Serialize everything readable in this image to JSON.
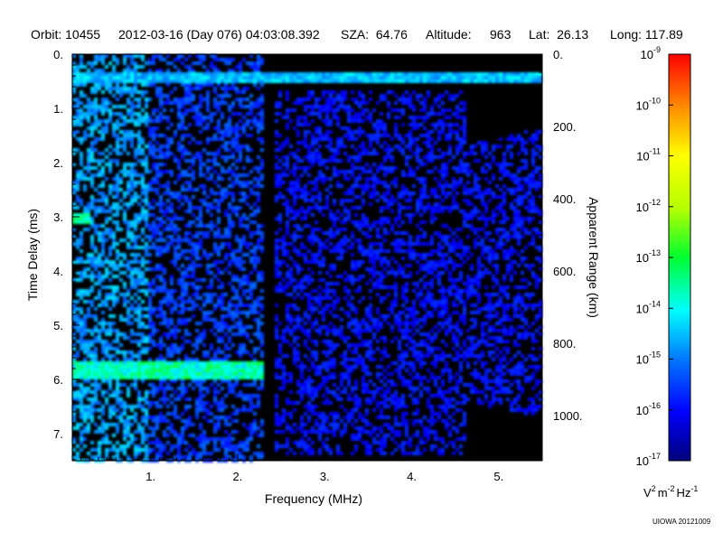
{
  "header": {
    "orbit": "Orbit: 10455",
    "datetime": "2012-03-16 (Day 076) 04:03:08.392",
    "sza": "SZA:  64.76",
    "altitude_label": "Altitude:",
    "altitude_value": "963",
    "lat": "Lat:  26.13",
    "long": "Long: 117.89"
  },
  "credit": "UIOWA 20121009",
  "chart_data": {
    "type": "heatmap",
    "title": "",
    "xlabel": "Frequency (MHz)",
    "ylabel": "Time Delay (ms)",
    "ylabel_right": "Apparent Range (km)",
    "xlim": [
      0.1,
      5.5
    ],
    "ylim": [
      7.5,
      0
    ],
    "x_ticks": [
      1,
      2,
      3,
      4,
      5
    ],
    "x_tick_labels": [
      "1.",
      "2.",
      "3.",
      "4.",
      "5."
    ],
    "y_ticks": [
      0,
      1,
      2,
      3,
      4,
      5,
      6,
      7
    ],
    "y_tick_labels": [
      "0.",
      "1.",
      "2.",
      "3.",
      "4.",
      "5.",
      "6.",
      "7."
    ],
    "y2_ticks": [
      0,
      200,
      400,
      600,
      800,
      1000
    ],
    "y2_tick_labels": [
      "0.",
      "200.",
      "400.",
      "600.",
      "800.",
      "1000."
    ],
    "y2_lim": [
      0,
      1125
    ],
    "colorbar": {
      "scale": "log",
      "min": 1e-17,
      "max": 1e-09,
      "unit_label": "V",
      "unit_sup1": "2",
      "unit_mid": "m",
      "unit_sup2": "-2",
      "unit_end": "Hz",
      "unit_sup3": "-1",
      "tick_exponents": [
        -9,
        -10,
        -11,
        -12,
        -13,
        -14,
        -15,
        -16,
        -17
      ],
      "tick_base": "10",
      "colors": [
        "#000080",
        "#0000ff",
        "#0080ff",
        "#00ffff",
        "#00ff00",
        "#c0ff00",
        "#ffff00",
        "#ff8000",
        "#ff0000"
      ]
    },
    "features": [
      {
        "name": "surface reflection",
        "delay_ms": 0.4,
        "freq_range": [
          0.1,
          5.5
        ],
        "level_log10": -14.5
      },
      {
        "name": "echo band",
        "delay_ms": 5.8,
        "freq_range": [
          0.1,
          2.3
        ],
        "level_log10": -13.5
      },
      {
        "name": "echo band",
        "delay_ms": 3.0,
        "freq_range": [
          0.1,
          0.3
        ],
        "level_log10": -13.5
      },
      {
        "name": "noise region",
        "delay_ms": [
          0.5,
          7.5
        ],
        "freq_range": [
          2.4,
          5.5
        ],
        "level_log10": -16.3
      }
    ]
  }
}
